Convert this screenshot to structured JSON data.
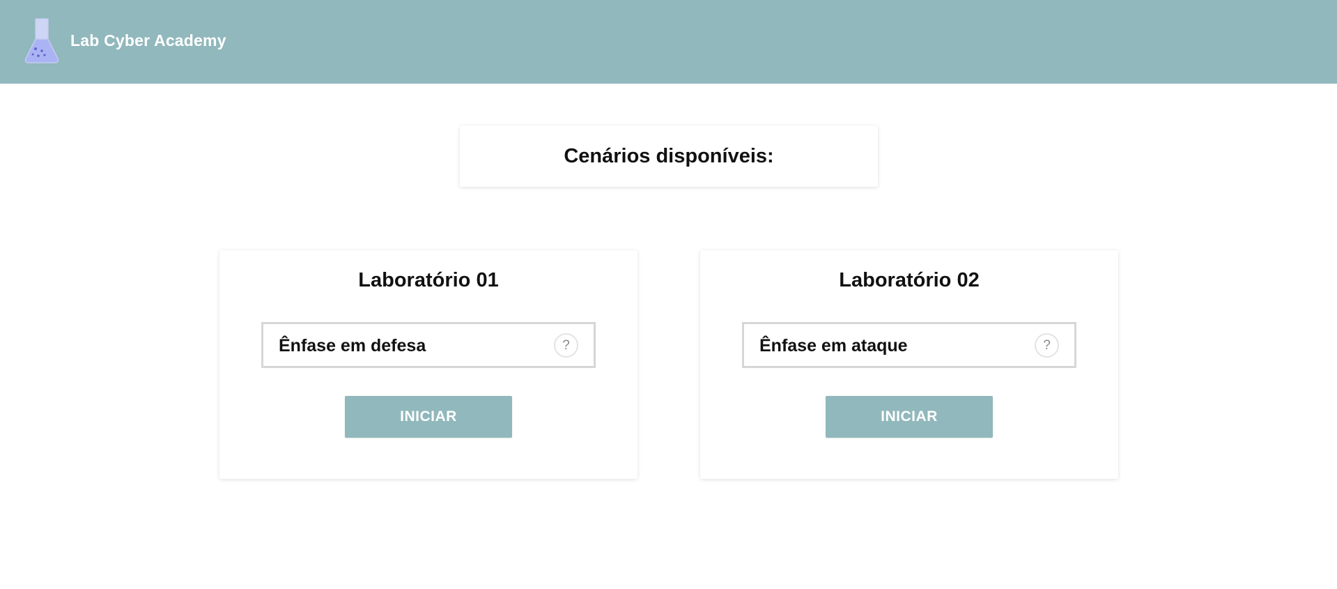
{
  "header": {
    "brand_name": "Lab Cyber Academy",
    "logo_icon": "flask-icon",
    "background_color": "#91b8bc"
  },
  "scenarios": {
    "title": "Cenários disponíveis:"
  },
  "labs": [
    {
      "title": "Laboratório 01",
      "emphasis": "Ênfase em defesa",
      "help_icon": "?",
      "button_label": "INICIAR"
    },
    {
      "title": "Laboratório 02",
      "emphasis": "Ênfase em ataque",
      "help_icon": "?",
      "button_label": "INICIAR"
    }
  ]
}
